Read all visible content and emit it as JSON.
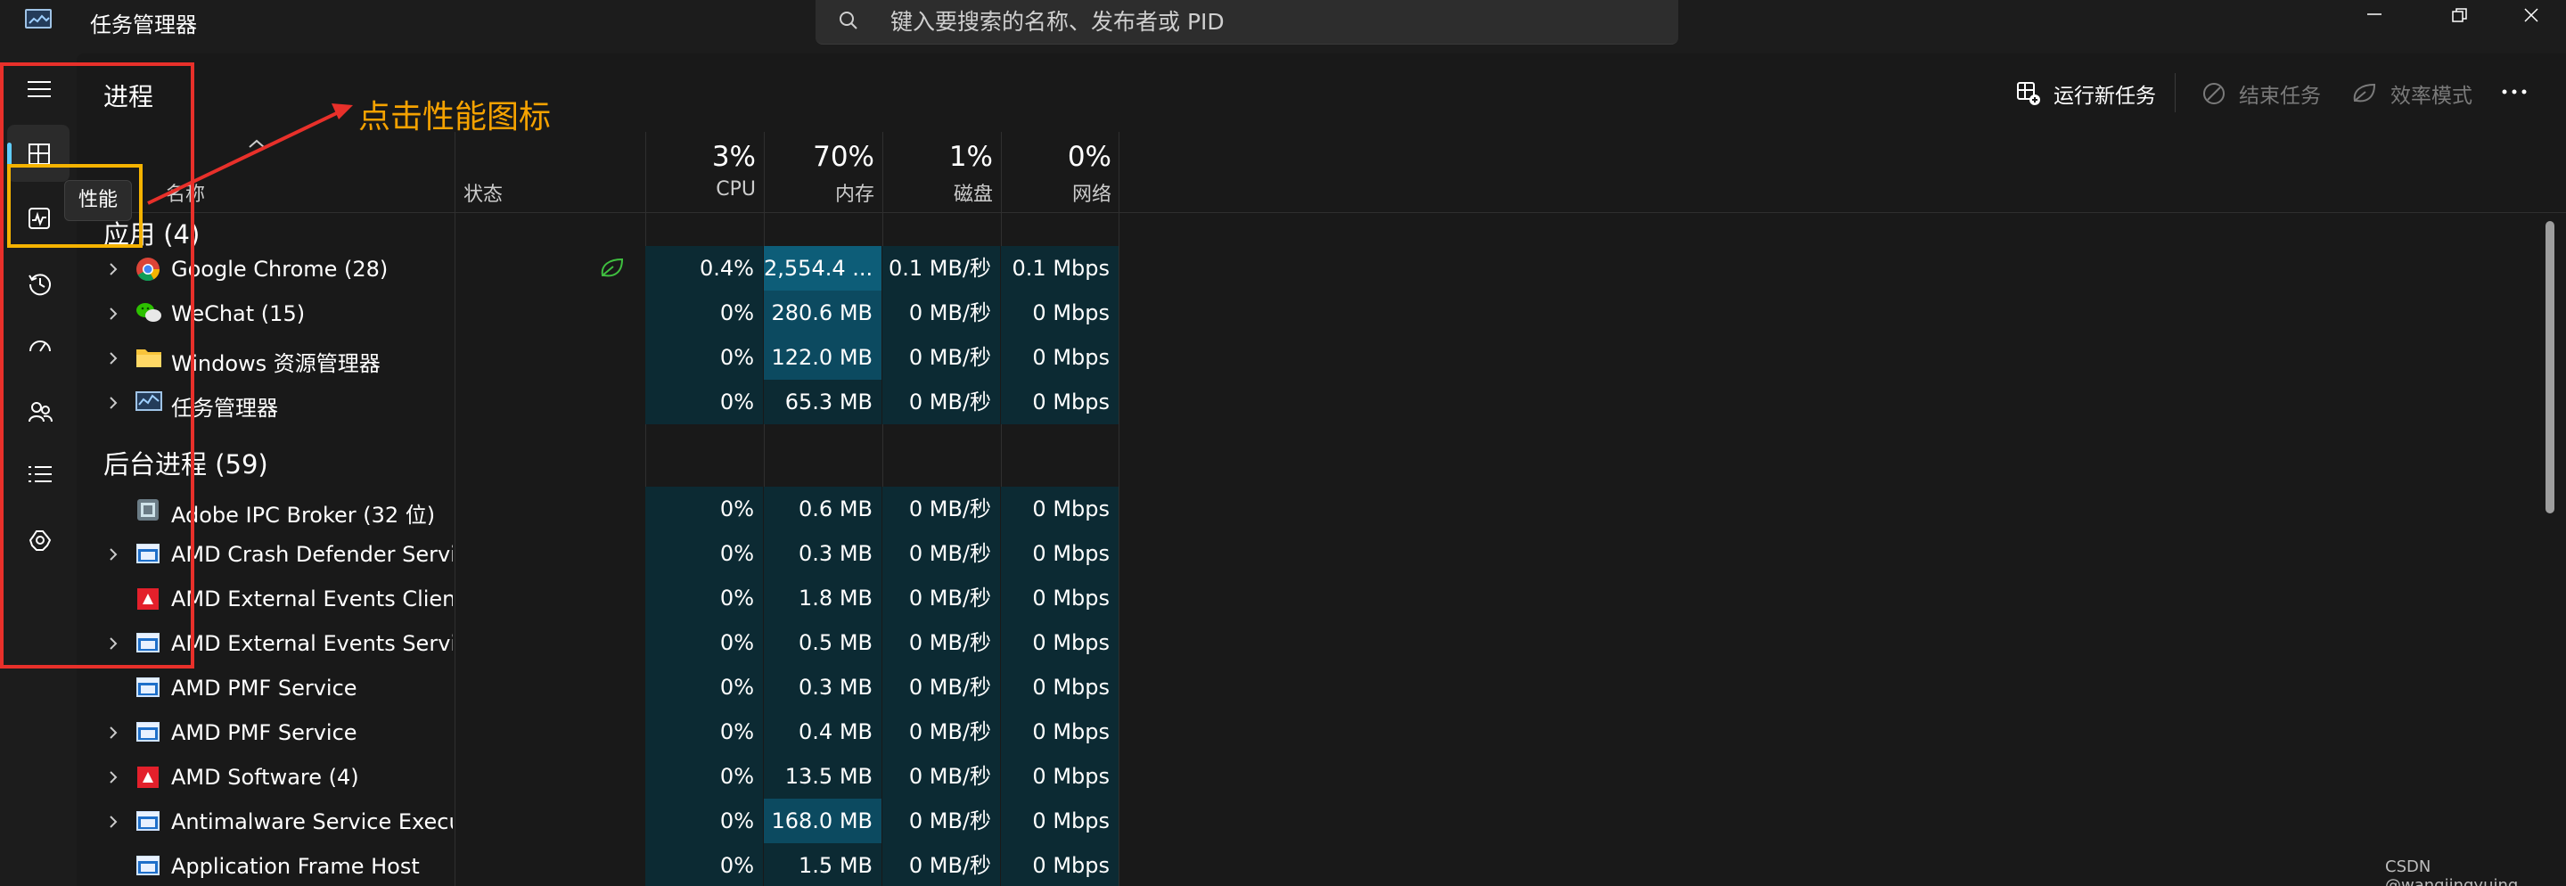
{
  "window": {
    "title": "任务管理器",
    "search_placeholder": "键入要搜索的名称、发布者或 PID"
  },
  "sidebar": {
    "tooltip": "性能",
    "items": [
      {
        "name": "hamburger-menu",
        "icon": "hamburger-icon"
      },
      {
        "name": "processes",
        "icon": "processes-icon",
        "selected": true
      },
      {
        "name": "performance",
        "icon": "performance-icon"
      },
      {
        "name": "app-history",
        "icon": "history-icon"
      },
      {
        "name": "startup-apps",
        "icon": "startup-icon"
      },
      {
        "name": "users",
        "icon": "users-icon"
      },
      {
        "name": "details",
        "icon": "details-icon"
      },
      {
        "name": "services",
        "icon": "services-icon"
      }
    ]
  },
  "header": {
    "page_title": "进程",
    "run_new_task": "运行新任务",
    "end_task": "结束任务",
    "efficiency_mode": "效率模式"
  },
  "columns": {
    "name": "名称",
    "status": "状态",
    "cpu_pct": "3%",
    "cpu_label": "CPU",
    "mem_pct": "70%",
    "mem_label": "内存",
    "disk_pct": "1%",
    "disk_label": "磁盘",
    "net_pct": "0%",
    "net_label": "网络"
  },
  "groups": {
    "apps": "应用 (4)",
    "background": "后台进程 (59)"
  },
  "apps": [
    {
      "name": "Google Chrome (28)",
      "cpu": "0.4%",
      "mem": "2,554.4 ...",
      "disk": "0.1 MB/秒",
      "net": "0.1 Mbps",
      "icon": "chrome-icon"
    },
    {
      "name": "WeChat (15)",
      "cpu": "0%",
      "mem": "280.6 MB",
      "disk": "0 MB/秒",
      "net": "0 Mbps",
      "icon": "wechat-icon"
    },
    {
      "name": "Windows 资源管理器",
      "cpu": "0%",
      "mem": "122.0 MB",
      "disk": "0 MB/秒",
      "net": "0 Mbps",
      "icon": "folder-icon"
    },
    {
      "name": "任务管理器",
      "cpu": "0%",
      "mem": "65.3 MB",
      "disk": "0 MB/秒",
      "net": "0 Mbps",
      "icon": "taskmgr-icon"
    }
  ],
  "background": [
    {
      "name": "Adobe IPC Broker (32 位)",
      "cpu": "0%",
      "mem": "0.6 MB",
      "disk": "0 MB/秒",
      "net": "0 Mbps",
      "icon": "adobe-icon",
      "expand": false
    },
    {
      "name": "AMD Crash Defender Service",
      "cpu": "0%",
      "mem": "0.3 MB",
      "disk": "0 MB/秒",
      "net": "0 Mbps",
      "icon": "service-icon",
      "expand": true
    },
    {
      "name": "AMD External Events Client...",
      "cpu": "0%",
      "mem": "1.8 MB",
      "disk": "0 MB/秒",
      "net": "0 Mbps",
      "icon": "amd-icon",
      "expand": false
    },
    {
      "name": "AMD External Events Servic...",
      "cpu": "0%",
      "mem": "0.5 MB",
      "disk": "0 MB/秒",
      "net": "0 Mbps",
      "icon": "service-icon",
      "expand": true
    },
    {
      "name": "AMD PMF Service",
      "cpu": "0%",
      "mem": "0.3 MB",
      "disk": "0 MB/秒",
      "net": "0 Mbps",
      "icon": "service-icon",
      "expand": false
    },
    {
      "name": "AMD PMF Service",
      "cpu": "0%",
      "mem": "0.4 MB",
      "disk": "0 MB/秒",
      "net": "0 Mbps",
      "icon": "service-icon",
      "expand": true
    },
    {
      "name": "AMD Software (4)",
      "cpu": "0%",
      "mem": "13.5 MB",
      "disk": "0 MB/秒",
      "net": "0 Mbps",
      "icon": "amd-icon",
      "expand": true
    },
    {
      "name": "Antimalware Service Execut...",
      "cpu": "0%",
      "mem": "168.0 MB",
      "disk": "0 MB/秒",
      "net": "0 Mbps",
      "icon": "service-icon",
      "expand": true
    },
    {
      "name": "Application Frame Host",
      "cpu": "0%",
      "mem": "1.5 MB",
      "disk": "0 MB/秒",
      "net": "0 Mbps",
      "icon": "service-icon",
      "expand": false
    }
  ],
  "annotation": {
    "text": "点击性能图标"
  },
  "watermark": "CSDN @wangjingyuing",
  "colors": {
    "accent": "#60cdff",
    "heat_low": "#0c2a33",
    "heat_mid": "#0c4a60",
    "heat_high": "#0d5d78",
    "annotation_red": "#e8302a",
    "annotation_orange": "#f5a200"
  }
}
